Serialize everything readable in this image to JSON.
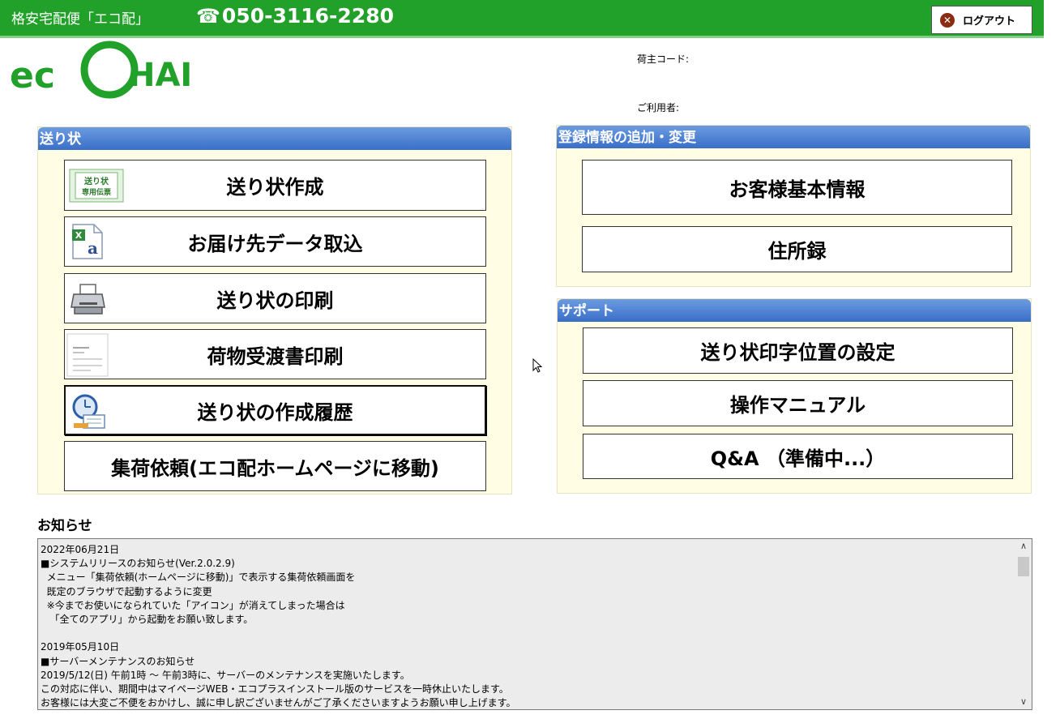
{
  "header": {
    "brand_title": "格安宅配便「エコ配」",
    "phone_icon": "☎",
    "phone": "050-3116-2280",
    "logout_label": "ログアウト",
    "logout_icon": "✕",
    "logo_text": "ECOHAI"
  },
  "account": {
    "shipper_code_label": "荷主コード:",
    "user_label": "ご利用者:"
  },
  "invoice_panel": {
    "title": "送り状",
    "buttons": [
      {
        "label": "送り状作成"
      },
      {
        "label": "お届け先データ取込"
      },
      {
        "label": "送り状の印刷"
      },
      {
        "label": "荷物受渡書印刷"
      },
      {
        "label": "送り状の作成履歴"
      },
      {
        "label": "集荷依頼(エコ配ホームページに移動)"
      }
    ],
    "invoice_icon_text": [
      "送り状",
      "専用伝票"
    ]
  },
  "registration_panel": {
    "title": "登録情報の追加・変更",
    "buttons": [
      {
        "label": "お客様基本情報"
      },
      {
        "label": "住所録"
      }
    ]
  },
  "support_panel": {
    "title": "サポート",
    "buttons": [
      {
        "label": "送り状印字位置の設定"
      },
      {
        "label": "操作マニュアル"
      },
      {
        "label": "Q&A （準備中...）"
      }
    ]
  },
  "news": {
    "title": "お知らせ",
    "lines": [
      "2022年06月21日",
      "■システムリリースのお知らせ(Ver.2.0.2.9)",
      "  メニュー「集荷依頼(ホームページに移動)」で表示する集荷依頼画面を",
      "  既定のブラウザで起動するように変更",
      "  ※今までお使いになられていた「アイコン」が消えてしまった場合は",
      "   「全てのアプリ」から起動をお願い致します。",
      "",
      "2019年05月10日",
      "■サーバーメンテナンスのお知らせ",
      "2019/5/12(日) 午前1時 ～ 午前3時に、サーバーのメンテナンスを実施いたします。",
      "この対応に伴い、期間中はマイページWEB・エコプラスインストール版のサービスを一時休止いたします。",
      "お客様には大変ご不便をおかけし、誠に申し訳ございませんがご了承くださいますようお願い申し上げます。"
    ]
  },
  "colors": {
    "header_green": "#21a129",
    "panel_header_blue": "#3a6fc8",
    "panel_bg": "#fffde3"
  }
}
